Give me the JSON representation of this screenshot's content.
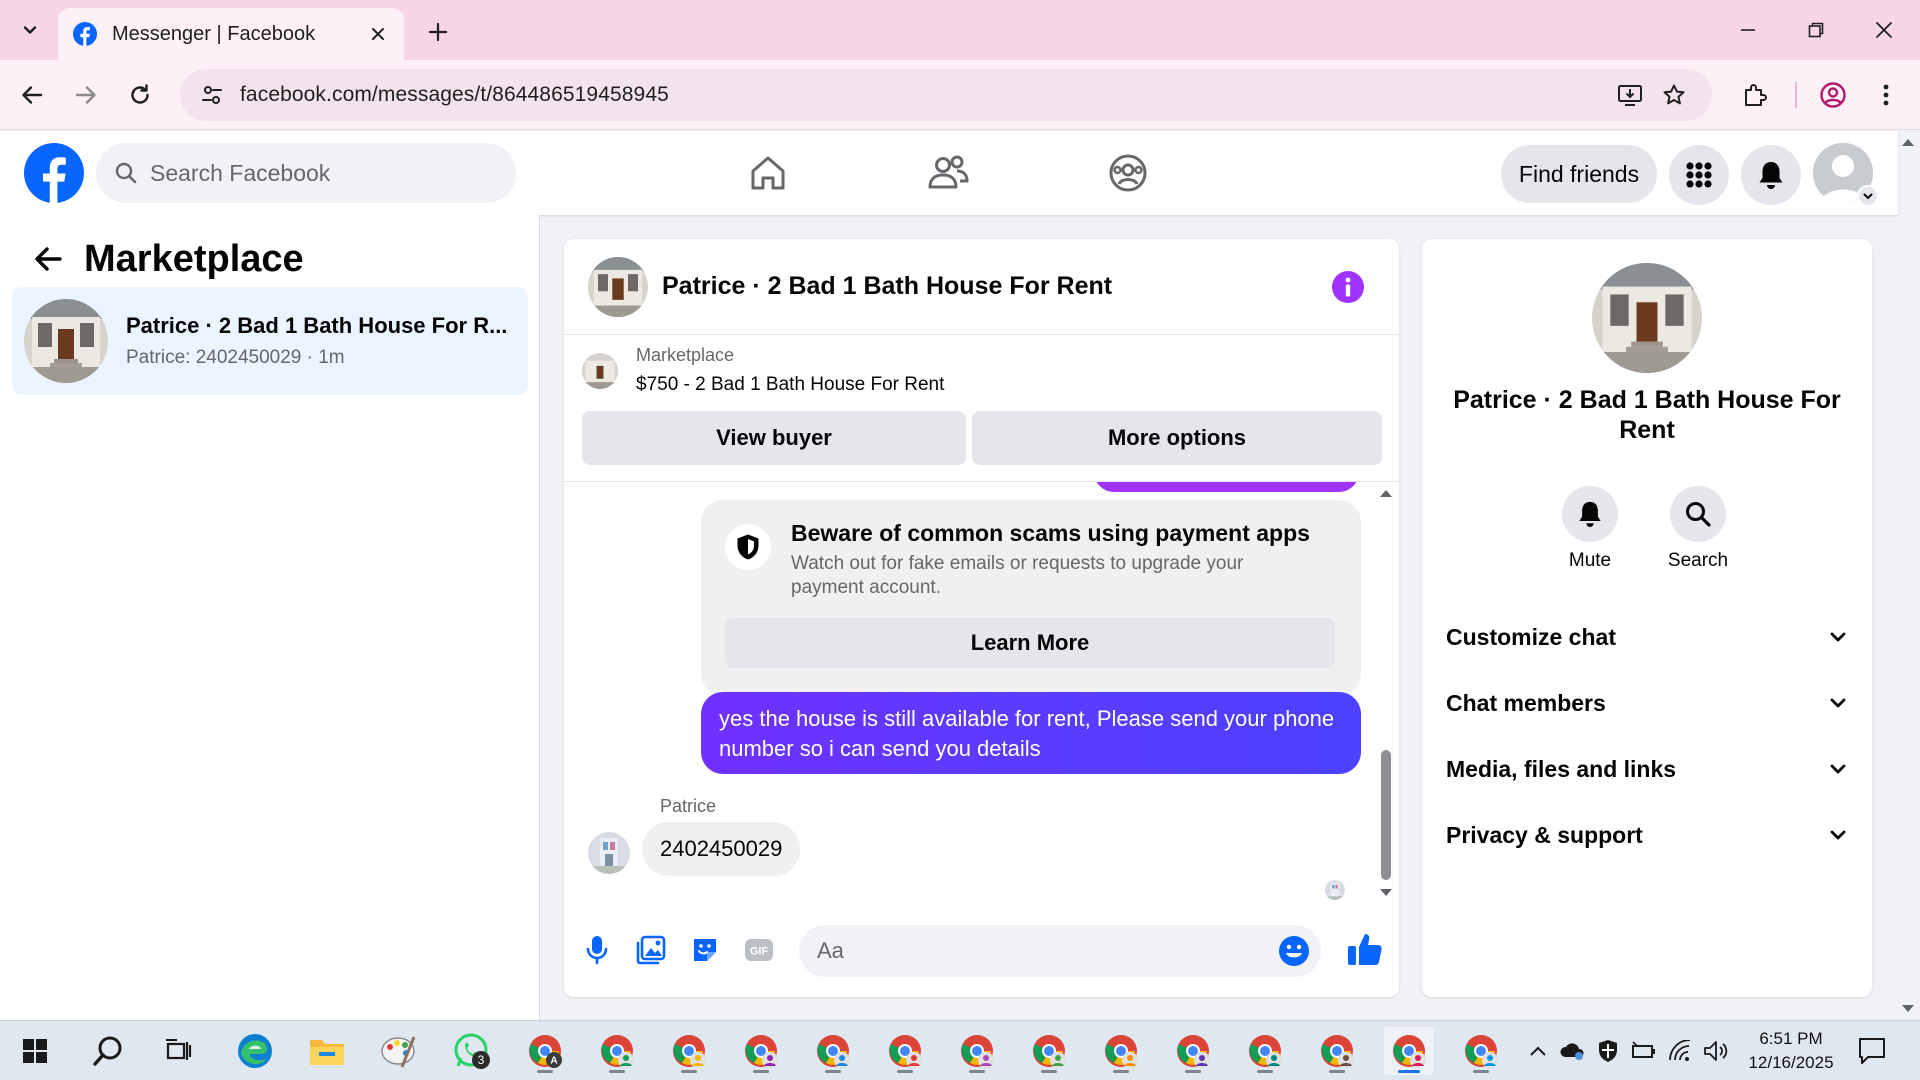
{
  "browser": {
    "tab_title": "Messenger | Facebook",
    "url": "facebook.com/messages/t/864486519458945",
    "icons": [
      "tab-search-icon",
      "facebook-favicon",
      "close-icon",
      "plus-icon",
      "minimize-icon",
      "restore-icon",
      "close-window-icon",
      "back-icon",
      "forward-icon",
      "reload-icon",
      "site-info-icon",
      "install-app-icon",
      "bookmark-star-icon",
      "extensions-icon",
      "profile-icon",
      "menu-icon"
    ]
  },
  "fb_header": {
    "search_placeholder": "Search Facebook",
    "find_friends_label": "Find friends",
    "nav_icons": [
      "home-icon",
      "friends-icon",
      "groups-icon"
    ],
    "right_icons": [
      "menu-grid-icon",
      "notifications-bell-icon",
      "account-avatar"
    ]
  },
  "sidebar": {
    "title": "Marketplace",
    "conversations": [
      {
        "title": "Patrice · 2 Bad 1 Bath House For R...",
        "subtitle": "Patrice: 2402450029 · 1m"
      }
    ]
  },
  "chat": {
    "title": "Patrice · 2 Bad 1 Bath House For Rent",
    "marketplace_label": "Marketplace",
    "listing": "$750 - 2 Bad 1 Bath House For Rent",
    "view_buyer_label": "View buyer",
    "more_options_label": "More options",
    "scam_notice": {
      "title": "Beware of common scams using payment apps",
      "body": "Watch out for fake emails or requests to upgrade your payment account.",
      "button_label": "Learn More"
    },
    "messages": [
      {
        "from": "me",
        "text": "yes the house is still available for rent, Please send your phone number so i can send you details"
      },
      {
        "from": "Patrice",
        "sender_label": "Patrice",
        "text": "2402450029"
      }
    ],
    "composer": {
      "placeholder": "Aa",
      "icons": [
        "microphone-icon",
        "photo-icon",
        "sticker-icon",
        "gif-icon",
        "emoji-icon",
        "thumbs-up-icon"
      ]
    },
    "accent_color": "#a033ff",
    "outgoing_bubble_color": "#5a3cff"
  },
  "info_panel": {
    "title": "Patrice · 2 Bad 1 Bath House For Rent",
    "actions": [
      {
        "label": "Mute",
        "icon": "bell-icon"
      },
      {
        "label": "Search",
        "icon": "search-icon"
      }
    ],
    "sections": [
      {
        "label": "Customize chat"
      },
      {
        "label": "Chat members"
      },
      {
        "label": "Media, files and links"
      },
      {
        "label": "Privacy & support"
      }
    ]
  },
  "taskbar": {
    "clock_time": "6:51 PM",
    "clock_date": "12/16/2025",
    "whatsapp_badge": "3",
    "chrome_profile_letter": "A"
  }
}
